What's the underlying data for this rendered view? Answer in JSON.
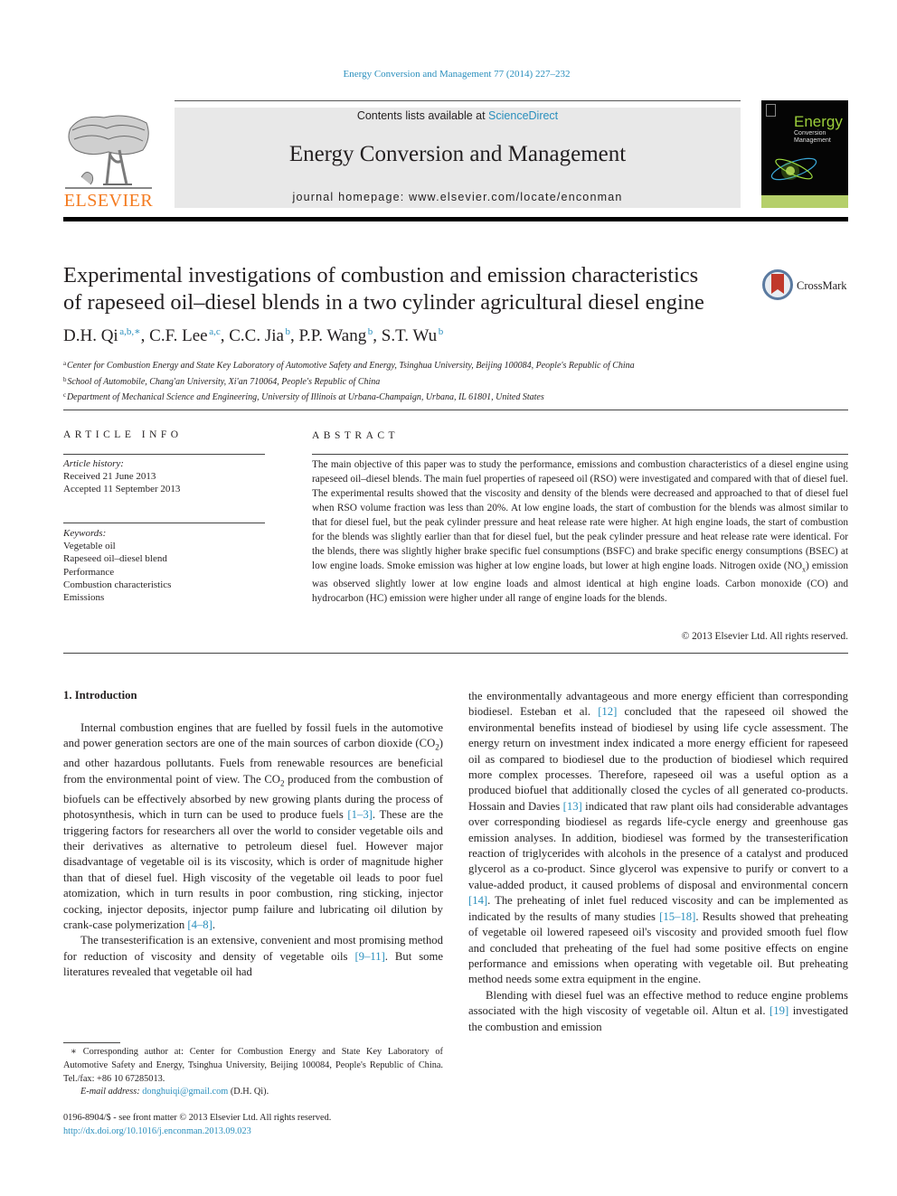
{
  "header": {
    "journal_ref": "Energy Conversion and Management 77 (2014) 227–232",
    "contents_prefix": "Contents lists available at ",
    "contents_link": "ScienceDirect",
    "journal_title": "Energy Conversion and Management",
    "homepage": "journal homepage: www.elsevier.com/locate/enconman",
    "publisher_logo_text": "ELSEVIER",
    "cover": {
      "line1": "Energy",
      "line2": "Conversion",
      "line3": "Management"
    },
    "colors": {
      "link": "#2a8fbd",
      "elsevier_orange": "#f47b20",
      "banner_gray": "#e8e8e8",
      "cover_green": "#9ccf3a"
    }
  },
  "article": {
    "title_line1": "Experimental investigations of combustion and emission characteristics",
    "title_line2": "of rapeseed oil–diesel blends in a two cylinder agricultural diesel engine",
    "crossmark_label": "CrossMark",
    "authors": [
      {
        "name": "D.H. Qi",
        "sup": "a,b,∗",
        "sep": ", "
      },
      {
        "name": "C.F. Lee",
        "sup": "a,c",
        "sep": ", "
      },
      {
        "name": "C.C. Jia",
        "sup": "b",
        "sep": ", "
      },
      {
        "name": "P.P. Wang",
        "sup": "b",
        "sep": ", "
      },
      {
        "name": "S.T. Wu",
        "sup": "b",
        "sep": ""
      }
    ],
    "affiliations": [
      {
        "key": "a",
        "text": "Center for Combustion Energy and State Key Laboratory of Automotive Safety and Energy, Tsinghua University, Beijing 100084, People's Republic of China"
      },
      {
        "key": "b",
        "text": "School of Automobile, Chang'an University, Xi'an 710064, People's Republic of China"
      },
      {
        "key": "c",
        "text": "Department of Mechanical Science and Engineering, University of Illinois at Urbana-Champaign, Urbana, IL 61801, United States"
      }
    ]
  },
  "article_info": {
    "heading": "ARTICLE INFO",
    "history_label": "Article history:",
    "received": "Received 21 June 2013",
    "accepted": "Accepted 11 September 2013",
    "keywords_label": "Keywords:",
    "keywords": [
      "Vegetable oil",
      "Rapeseed oil–diesel blend",
      "Performance",
      "Combustion characteristics",
      "Emissions"
    ]
  },
  "abstract": {
    "heading": "ABSTRACT",
    "text_part1": "The main objective of this paper was to study the performance, emissions and combustion characteristics of a diesel engine using rapeseed oil–diesel blends. The main fuel properties of rapeseed oil (RSO) were investigated and compared with that of diesel fuel. The experimental results showed that the viscosity and density of the blends were decreased and approached to that of diesel fuel when RSO volume fraction was less than 20%. At low engine loads, the start of combustion for the blends was almost similar to that for diesel fuel, but the peak cylinder pressure and heat release rate were higher. At high engine loads, the start of combustion for the blends was slightly earlier than that for diesel fuel, but the peak cylinder pressure and heat release rate were identical. For the blends, there was slightly higher brake specific fuel consumptions (BSFC) and brake specific energy consumptions (BSEC) at low engine loads. Smoke emission was higher at low engine loads, but lower at high engine loads. Nitrogen oxide (NO",
    "text_sub": "x",
    "text_part2": ") emission was observed slightly lower at low engine loads and almost identical at high engine loads. Carbon monoxide (CO) and hydrocarbon (HC) emission were higher under all range of engine loads for the blends.",
    "copyright": "© 2013 Elsevier Ltd. All rights reserved."
  },
  "body": {
    "section_heading": "1. Introduction",
    "left_col": {
      "p1_a": "Internal combustion engines that are fuelled by fossil fuels in the automotive and power generation sectors are one of the main sources of carbon dioxide (CO",
      "p1_sub1": "2",
      "p1_b": ") and other hazardous pollutants. Fuels from renewable resources are beneficial from the environmental point of view. The CO",
      "p1_sub2": "2",
      "p1_c": " produced from the combustion of biofuels can be effectively absorbed by new growing plants during the process of photosynthesis, which in turn can be used to produce fuels ",
      "p1_ref1": "[1–3]",
      "p1_d": ". These are the triggering factors for researchers all over the world to consider vegetable oils and their derivatives as alternative to petroleum diesel fuel. However major disadvantage of vegetable oil is its viscosity, which is order of magnitude higher than that of diesel fuel. High viscosity of the vegetable oil leads to poor fuel atomization, which in turn results in poor combustion, ring sticking, injector cocking, injector deposits, injector pump failure and lubricating oil dilution by crank-case polymerization ",
      "p1_ref2": "[4–8]",
      "p1_e": ".",
      "p2_a": "The transesterification is an extensive, convenient and most promising method for reduction of viscosity and density of vegetable oils ",
      "p2_ref": "[9–11]",
      "p2_b": ". But some literatures revealed that vegetable oil had"
    },
    "right_col": {
      "p1_a": "the environmentally advantageous and more energy efficient than corresponding biodiesel. Esteban et al. ",
      "ref12": "[12]",
      "p1_b": " concluded that the rapeseed oil showed the environmental benefits instead of biodiesel by using life cycle assessment. The energy return on investment index indicated a more energy efficient for rapeseed oil as compared to biodiesel due to the production of biodiesel which required more complex processes. Therefore, rapeseed oil was a useful option as a produced biofuel that additionally closed the cycles of all generated co-products. Hossain and Davies ",
      "ref13": "[13]",
      "p1_c": " indicated that raw plant oils had considerable advantages over corresponding biodiesel as regards life-cycle energy and greenhouse gas emission analyses. In addition, biodiesel was formed by the transesterification reaction of triglycerides with alcohols in the presence of a catalyst and produced glycerol as a co-product. Since glycerol was expensive to purify or convert to a value-added product, it caused problems of disposal and environmental concern ",
      "ref14": "[14]",
      "p1_d": ". The preheating of inlet fuel reduced viscosity and can be implemented as indicated by the results of many studies ",
      "ref15": "[15–18]",
      "p1_e": ". Results showed that preheating of vegetable oil lowered rapeseed oil's viscosity and provided smooth fuel flow and concluded that preheating of the fuel had some positive effects on engine performance and emissions when operating with vegetable oil. But preheating method needs some extra equipment in the engine.",
      "p2_a": "Blending with diesel fuel was an effective method to reduce engine problems associated with the high viscosity of vegetable oil. Altun et al. ",
      "ref19": "[19]",
      "p2_b": " investigated the combustion and emission"
    }
  },
  "footnotes": {
    "corresponding": "∗ Corresponding author at: Center for Combustion Energy and State Key Laboratory of Automotive Safety and Energy, Tsinghua University, Beijing 100084, People's Republic of China. Tel./fax: +86 10 67285013.",
    "email_label": "E-mail address:",
    "email": "donghuiqi@gmail.com",
    "email_suffix": " (D.H. Qi).",
    "front_matter": "0196-8904/$ - see front matter © 2013 Elsevier Ltd. All rights reserved.",
    "doi": "http://dx.doi.org/10.1016/j.enconman.2013.09.023"
  }
}
